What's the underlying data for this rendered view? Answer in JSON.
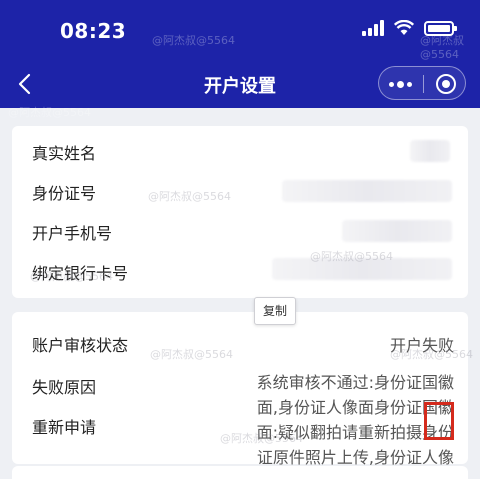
{
  "status_bar": {
    "time": "08:23"
  },
  "nav": {
    "title": "开户设置"
  },
  "account_info": {
    "name_label": "真实姓名",
    "id_label": "身份证号",
    "phone_label": "开户手机号",
    "bank_label": "绑定银行卡号"
  },
  "copy_tooltip": "复制",
  "review": {
    "status_label": "账户审核状态",
    "status_value": "开户失败",
    "reason_label": "失败原因",
    "reapply_label": "重新申请",
    "reason_text": "系统审核不通过:身份证国徽面,身份证人像面身份证国徽面:疑似翻拍请重新拍摄身份证原件照片上传,身份证人像面:疑"
  },
  "watermark": "@阿杰叔@5564",
  "colors": {
    "header_bg": "#1d23a8",
    "highlight": "#d42a1c"
  }
}
